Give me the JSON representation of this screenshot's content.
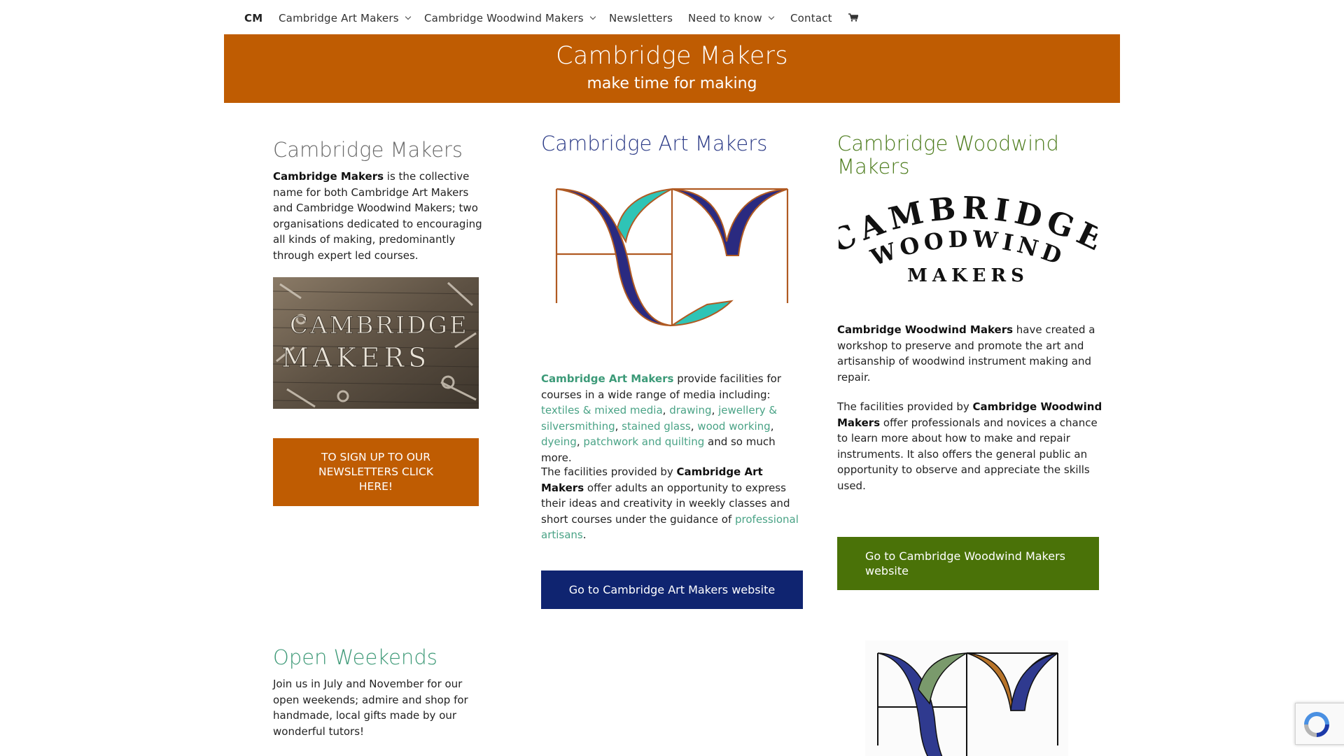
{
  "nav": {
    "brand": "CM",
    "items": [
      {
        "label": "Cambridge Art Makers",
        "dropdown": true
      },
      {
        "label": "Cambridge Woodwind Makers",
        "dropdown": true
      },
      {
        "label": "Newsletters",
        "dropdown": false
      },
      {
        "label": "Need to know",
        "dropdown": true
      },
      {
        "label": "Contact",
        "dropdown": false
      }
    ],
    "cart_icon": "shopping-cart-icon"
  },
  "banner": {
    "title": "Cambridge Makers",
    "subtitle": "make time for making"
  },
  "colors": {
    "orange": "#bf5c02",
    "navy": "#0f2470",
    "green": "#4a7208",
    "teal_link": "#4aa386"
  },
  "left": {
    "heading": "Cambridge Makers",
    "intro_bold": "Cambridge Makers",
    "intro_rest": " is the collective name for both Cambridge Art Makers and Cambridge Woodwind Makers; two organisations dedicated to encouraging all kinds of making, predominantly through expert led courses.",
    "photo_text_line1": "CAMBRIDGE",
    "photo_text_line2": "MAKERS",
    "newsletter_button": "TO SIGN UP TO OUR NEWSLETTERS CLICK HERE!",
    "open_heading": "Open Weekends",
    "open_text": "Join us in July and November for our open weekends; admire and shop for handmade, local gifts made by our wonderful tutors!"
  },
  "middle": {
    "heading": "Cambridge Art Makers",
    "p1_link": "Cambridge Art Makers",
    "p1_text": " provide facilities for courses in a wide range of media including: ",
    "media": [
      "textiles & mixed media",
      "drawing",
      "jewellery & silversmithing",
      "stained glass",
      "wood working",
      "dyeing",
      "patchwork and quilting"
    ],
    "p1_end": " and so much more.",
    "p2_start": "The facilities provided by ",
    "p2_bold": "Cambridge Art Makers",
    "p2_text": " offer adults an opportunity to express their ideas and creativity in weekly classes and short courses under the guidance of ",
    "p2_link": "professional artisans",
    "p2_end": ".",
    "button": "Go to Cambridge Art Makers website"
  },
  "right": {
    "heading": "Cambridge Woodwind Makers",
    "logo_line1": "CAMBRIDGE",
    "logo_line2": "WOODWIND",
    "logo_line3": "MAKERS",
    "p1_bold": "Cambridge Woodwind Makers",
    "p1_text": " have created a workshop to preserve and promote the art and artisanship of woodwind instrument making and repair.",
    "p2_start": "The facilities provided by ",
    "p2_bold": "Cambridge Woodwind Makers",
    "p2_text": " offer professionals and novices a chance to learn more about how to make and repair instruments. It also offers the general public an opportunity to observe and appreciate the skills used.",
    "button": "Go to Cambridge Woodwind Makers website"
  }
}
